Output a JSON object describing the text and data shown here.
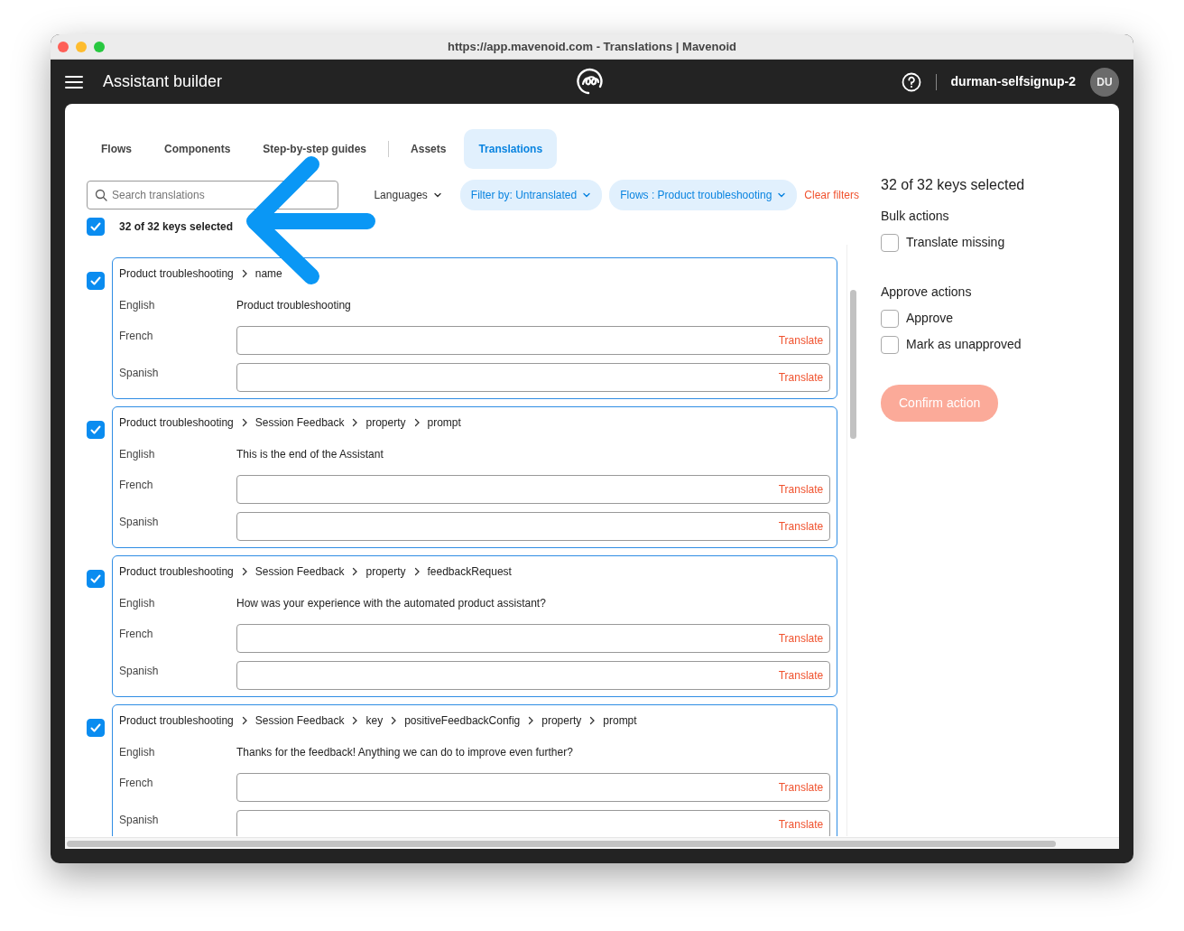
{
  "window": {
    "title": "https://app.mavenoid.com - Translations | Mavenoid"
  },
  "app_bar": {
    "title": "Assistant builder",
    "user": "durman-selfsignup-2",
    "avatar_initials": "DU"
  },
  "tabs": [
    {
      "label": "Flows",
      "selected": false
    },
    {
      "label": "Components",
      "selected": false
    },
    {
      "label": "Step-by-step guides",
      "selected": false,
      "divider_after": true
    },
    {
      "label": "Assets",
      "selected": false
    },
    {
      "label": "Translations",
      "selected": true
    }
  ],
  "search": {
    "placeholder": "Search translations"
  },
  "filters": [
    {
      "label": "Languages",
      "kind": "plain"
    },
    {
      "label": "Filter by: Untranslated",
      "kind": "chip"
    },
    {
      "label": "Flows : Product troubleshooting",
      "kind": "chip"
    }
  ],
  "clear_filters": "Clear filters",
  "select_all": {
    "label": "32 of 32 keys selected",
    "checked": true
  },
  "keys": [
    {
      "selected": true,
      "path": [
        "Product troubleshooting",
        "name"
      ],
      "rows": [
        {
          "language": "English",
          "kind": "text",
          "value": "Product troubleshooting"
        },
        {
          "language": "French",
          "kind": "field",
          "action": "Translate"
        },
        {
          "language": "Spanish",
          "kind": "field",
          "action": "Translate"
        }
      ]
    },
    {
      "selected": true,
      "path": [
        "Product troubleshooting",
        "Session Feedback",
        "property",
        "prompt"
      ],
      "rows": [
        {
          "language": "English",
          "kind": "text",
          "value": "This is the end of the Assistant"
        },
        {
          "language": "French",
          "kind": "field",
          "action": "Translate"
        },
        {
          "language": "Spanish",
          "kind": "field",
          "action": "Translate"
        }
      ]
    },
    {
      "selected": true,
      "path": [
        "Product troubleshooting",
        "Session Feedback",
        "property",
        "feedbackRequest"
      ],
      "rows": [
        {
          "language": "English",
          "kind": "text",
          "value": "How was your experience with the automated product assistant?"
        },
        {
          "language": "French",
          "kind": "field",
          "action": "Translate"
        },
        {
          "language": "Spanish",
          "kind": "field",
          "action": "Translate"
        }
      ]
    },
    {
      "selected": true,
      "path": [
        "Product troubleshooting",
        "Session Feedback",
        "key",
        "positiveFeedbackConfig",
        "property",
        "prompt"
      ],
      "rows": [
        {
          "language": "English",
          "kind": "text",
          "value": "Thanks for the feedback! Anything we can do to improve even further?"
        },
        {
          "language": "French",
          "kind": "field",
          "action": "Translate"
        },
        {
          "language": "Spanish",
          "kind": "field",
          "action": "Translate"
        }
      ]
    }
  ],
  "side_panel": {
    "title": "32 of 32 keys selected",
    "groups": [
      {
        "heading": "Bulk actions",
        "options": [
          {
            "label": "Translate missing",
            "checked": false
          }
        ]
      },
      {
        "heading": "Approve actions",
        "options": [
          {
            "label": "Approve",
            "checked": false
          },
          {
            "label": "Mark as unapproved",
            "checked": false
          }
        ]
      }
    ],
    "confirm": {
      "label": "Confirm action",
      "disabled": true
    }
  }
}
